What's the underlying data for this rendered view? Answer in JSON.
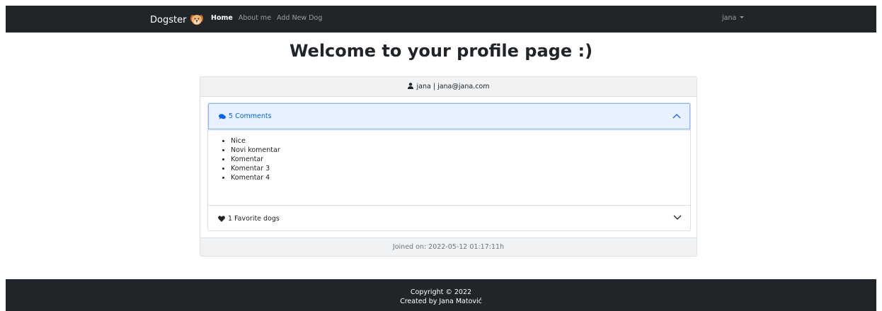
{
  "navbar": {
    "brand": "Dogster",
    "links": [
      "Home",
      "About me",
      "Add New Dog"
    ],
    "user": "jana"
  },
  "page": {
    "title": "Welcome to your profile page :)"
  },
  "profile": {
    "header": "jana | jana@jana.com",
    "comments_label": "5 Comments",
    "comments": [
      "Nice",
      "Novi komentar",
      "Komentar",
      "Komentar 3",
      "Komentar 4"
    ],
    "favorites_label": "1 Favorite dogs",
    "joined": "Joined on: 2022-05-12 01:17:11h"
  },
  "footer": {
    "copyright": "Copyright © 2022",
    "credit": "Created by Jana Matović"
  },
  "colors": {
    "navbar": "#212529",
    "accent": "#0c63e4",
    "accordion_open_bg": "#e7f1ff"
  }
}
